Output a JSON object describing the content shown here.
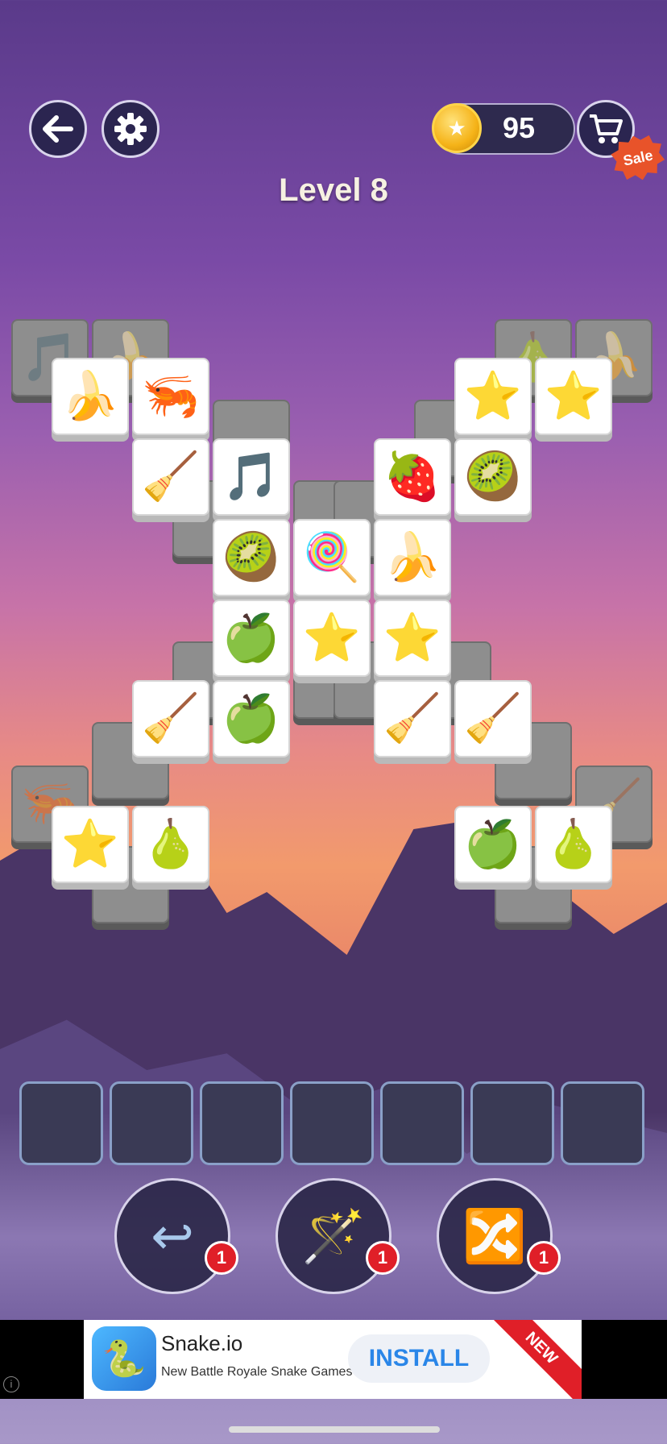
{
  "header": {
    "back_icon": "back-arrow-icon",
    "settings_icon": "gear-icon",
    "coins": "95",
    "sale_label": "Sale",
    "level_title": "Level 8"
  },
  "board": {
    "tiles": [
      {
        "icon": "music-note",
        "glyph": "🎵",
        "layer": "under",
        "slot": "t01"
      },
      {
        "icon": "banana",
        "glyph": "🍌",
        "layer": "under",
        "slot": "t02"
      },
      {
        "icon": "banana",
        "glyph": "🍌",
        "layer": "top",
        "slot": "t03"
      },
      {
        "icon": "shrimp",
        "glyph": "🦐",
        "layer": "top",
        "slot": "t04"
      },
      {
        "icon": "pear",
        "glyph": "🍐",
        "layer": "under",
        "slot": "t05"
      },
      {
        "icon": "banana",
        "glyph": "🍌",
        "layer": "under",
        "slot": "t06"
      },
      {
        "icon": "star",
        "glyph": "⭐",
        "layer": "top",
        "slot": "t07"
      },
      {
        "icon": "star",
        "glyph": "⭐",
        "layer": "top",
        "slot": "t08"
      },
      {
        "icon": "broom",
        "glyph": "🧹",
        "layer": "top",
        "slot": "t09"
      },
      {
        "icon": "music-note",
        "glyph": "🎵",
        "layer": "top",
        "slot": "t10"
      },
      {
        "icon": "strawberry",
        "glyph": "🍓",
        "layer": "top",
        "slot": "t11"
      },
      {
        "icon": "kiwi",
        "glyph": "🥝",
        "layer": "top",
        "slot": "t12"
      },
      {
        "icon": "kiwi",
        "glyph": "🥝",
        "layer": "top",
        "slot": "t13"
      },
      {
        "icon": "lollipop",
        "glyph": "🍭",
        "layer": "top",
        "slot": "t14"
      },
      {
        "icon": "banana",
        "glyph": "🍌",
        "layer": "top",
        "slot": "t15"
      },
      {
        "icon": "green-apple",
        "glyph": "🍏",
        "layer": "top",
        "slot": "t16"
      },
      {
        "icon": "star",
        "glyph": "⭐",
        "layer": "top",
        "slot": "t17"
      },
      {
        "icon": "star",
        "glyph": "⭐",
        "layer": "top",
        "slot": "t18"
      },
      {
        "icon": "broom",
        "glyph": "🧹",
        "layer": "top",
        "slot": "t19"
      },
      {
        "icon": "green-apple",
        "glyph": "🍏",
        "layer": "top",
        "slot": "t20"
      },
      {
        "icon": "broom",
        "glyph": "🧹",
        "layer": "top",
        "slot": "t21"
      },
      {
        "icon": "broom",
        "glyph": "🧹",
        "layer": "top",
        "slot": "t22"
      },
      {
        "icon": "shrimp",
        "glyph": "🦐",
        "layer": "under",
        "slot": "t23"
      },
      {
        "icon": "star",
        "glyph": "⭐",
        "layer": "top",
        "slot": "t24"
      },
      {
        "icon": "pear",
        "glyph": "🍐",
        "layer": "top",
        "slot": "t25"
      },
      {
        "icon": "green-apple",
        "glyph": "🍏",
        "layer": "top",
        "slot": "t26"
      },
      {
        "icon": "pear",
        "glyph": "🍐",
        "layer": "top",
        "slot": "t27"
      },
      {
        "icon": "broom",
        "glyph": "🧹",
        "layer": "under",
        "slot": "t28"
      }
    ]
  },
  "tray": {
    "slots": 7
  },
  "powerups": [
    {
      "name": "undo",
      "icon": "undo-arrow-icon",
      "glyph": "↩",
      "count": "1"
    },
    {
      "name": "magic-wand",
      "icon": "magic-wand-icon",
      "glyph": "🪄",
      "count": "1"
    },
    {
      "name": "shuffle",
      "icon": "shuffle-icon",
      "glyph": "🔀",
      "count": "1"
    }
  ],
  "ad": {
    "app_name": "Snake.io",
    "tagline": "New Battle Royale Snake Games",
    "install_label": "INSTALL",
    "ribbon": "NEW",
    "info": "i"
  },
  "colors": {
    "accent": "#2a86e8",
    "badge": "#e01f28",
    "sale": "#e8532a"
  }
}
